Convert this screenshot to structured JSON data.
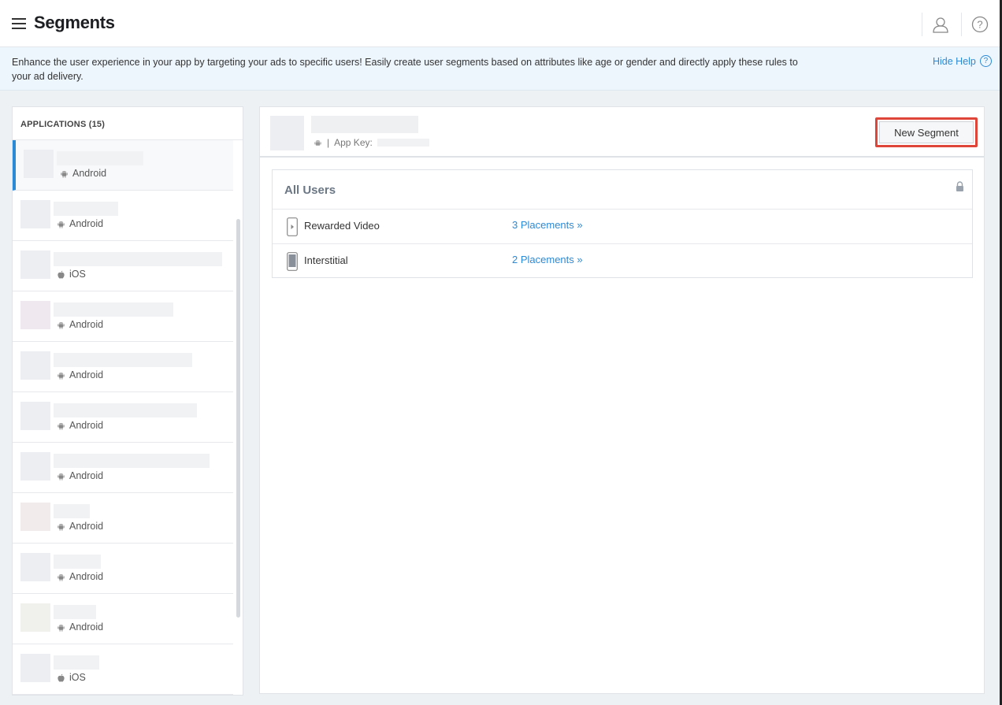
{
  "header": {
    "title": "Segments"
  },
  "help": {
    "text": "Enhance the user experience in your app by targeting your ads to specific users! Easily create user segments based on attributes like age or gender and directly apply these rules to your ad delivery.",
    "hide_label": "Hide Help"
  },
  "sidebar": {
    "heading": "APPLICATIONS (15)",
    "apps": [
      {
        "platform": "Android"
      },
      {
        "platform": "Android"
      },
      {
        "platform": "iOS"
      },
      {
        "platform": "Android"
      },
      {
        "platform": "Android"
      },
      {
        "platform": "Android"
      },
      {
        "platform": "Android"
      },
      {
        "platform": "Android"
      },
      {
        "platform": "Android"
      },
      {
        "platform": "Android"
      },
      {
        "platform": "iOS"
      }
    ]
  },
  "app_header": {
    "separator": "|",
    "key_label": "App Key:",
    "new_segment_label": "New Segment"
  },
  "segment": {
    "title": "All Users",
    "rows": [
      {
        "label": "Rewarded Video",
        "link": "3 Placements »"
      },
      {
        "label": "Interstitial",
        "link": "2 Placements »"
      }
    ]
  },
  "colors": {
    "accent": "#2b8ad6",
    "highlight": "#e0453a"
  }
}
